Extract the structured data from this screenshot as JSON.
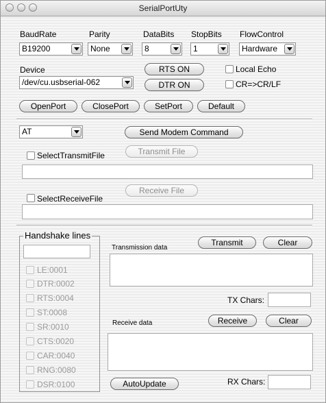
{
  "window": {
    "title": "SerialPortUty"
  },
  "settings": {
    "baudrate": {
      "label": "BaudRate",
      "value": "B19200"
    },
    "parity": {
      "label": "Parity",
      "value": "None"
    },
    "databits": {
      "label": "DataBits",
      "value": "8"
    },
    "stopbits": {
      "label": "StopBits",
      "value": "1"
    },
    "flowcontrol": {
      "label": "FlowControl",
      "value": "Hardware"
    }
  },
  "device": {
    "label": "Device",
    "value": "/dev/cu.usbserial-062"
  },
  "line_buttons": {
    "rts": "RTS ON",
    "dtr": "DTR ON"
  },
  "options": {
    "local_echo": "Local Echo",
    "cr_conv": "CR=>CR/LF"
  },
  "port_buttons": {
    "open": "OpenPort",
    "close": "ClosePort",
    "set": "SetPort",
    "default": "Default"
  },
  "modem": {
    "command": "AT",
    "send_label": "Send Modem Command"
  },
  "transmit_file": {
    "checkbox_label": "SelectTransmitFile",
    "button": "Transmit File",
    "path": ""
  },
  "receive_file": {
    "checkbox_label": "SelectReceiveFile",
    "button": "Receive File",
    "path": ""
  },
  "handshake": {
    "title": "Handshake lines",
    "value": "",
    "lines": [
      {
        "label": "LE:0001"
      },
      {
        "label": "DTR:0002"
      },
      {
        "label": "RTS:0004"
      },
      {
        "label": "ST:0008"
      },
      {
        "label": "SR:0010"
      },
      {
        "label": "CTS:0020"
      },
      {
        "label": "CAR:0040"
      },
      {
        "label": "RNG:0080"
      },
      {
        "label": "DSR:0100"
      }
    ]
  },
  "transmission": {
    "label": "Transmission data",
    "transmit": "Transmit",
    "clear": "Clear",
    "text": ""
  },
  "tx_chars": {
    "label": "TX Chars:",
    "value": ""
  },
  "receive": {
    "label": "Receive data",
    "receive": "Receive",
    "clear": "Clear",
    "text": ""
  },
  "autoupdate": "AutoUpdate",
  "rx_chars": {
    "label": "RX Chars:",
    "value": ""
  }
}
